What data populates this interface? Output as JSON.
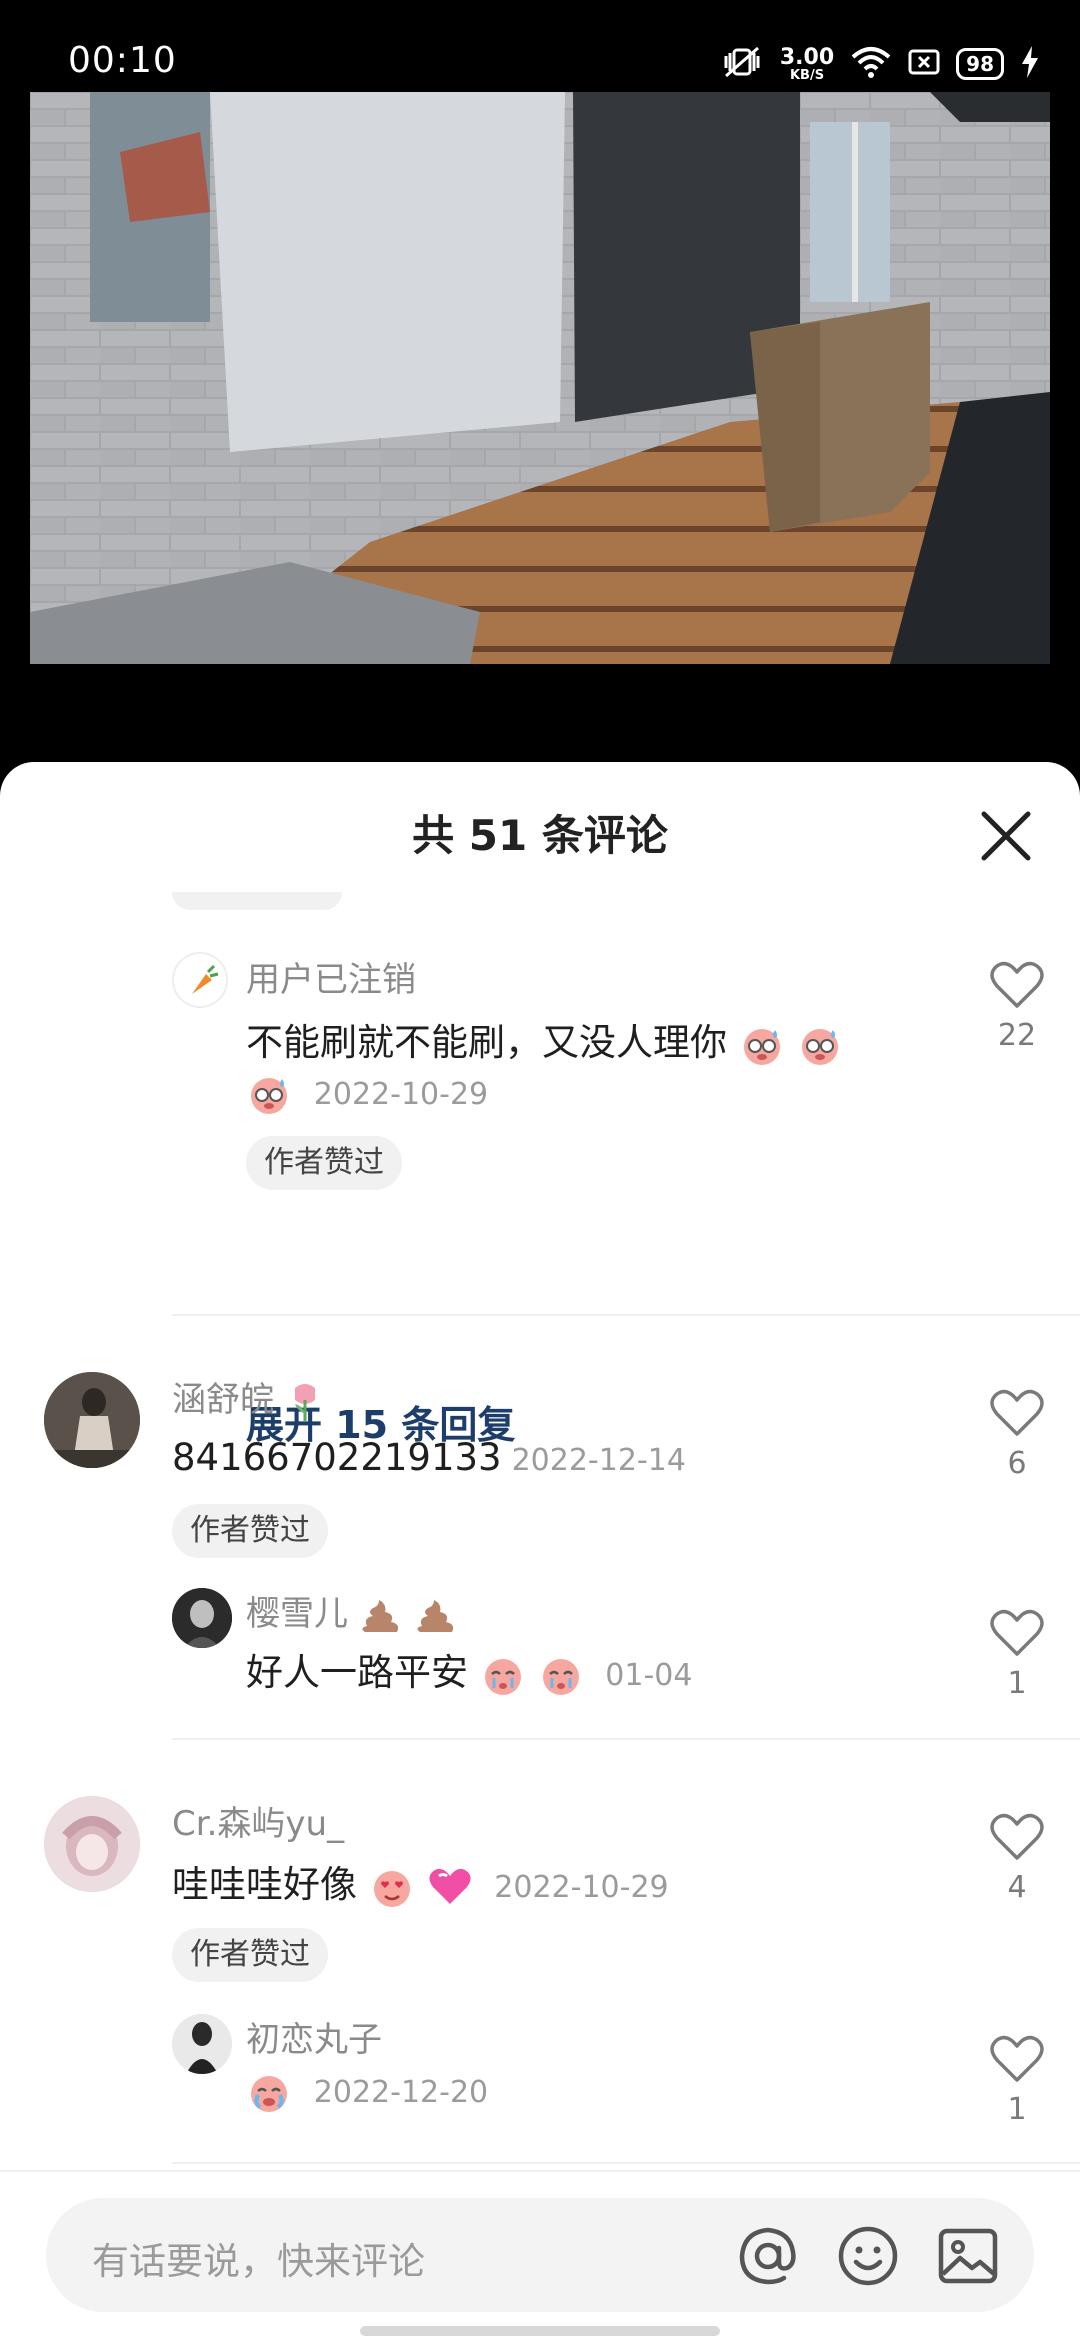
{
  "status_bar": {
    "time": "00:10",
    "net_speed": "3.00",
    "net_unit": "KB/S",
    "battery": "98",
    "icons": [
      "mute-vibrate-icon",
      "wifi-icon",
      "sim-icon",
      "battery-icon",
      "charging-icon"
    ]
  },
  "video": {
    "scene": "3d-room-scene"
  },
  "comments_sheet": {
    "title": "共 51 条评论",
    "comments": [
      {
        "user": "用户已注销",
        "text": "不能刷就不能刷，又没人理你",
        "date": "2022-10-29",
        "tag": "作者赞过",
        "likes": "22",
        "expand": "展开 15 条回复"
      },
      {
        "user": "涵舒皖",
        "text": "84166702219133",
        "date": "2022-12-14",
        "tag": "作者赞过",
        "likes": "6",
        "reply": {
          "user": "樱雪儿",
          "text": "好人一路平安",
          "date": "01-04",
          "likes": "1"
        }
      },
      {
        "user": "Cr.森屿yu_",
        "text": "哇哇哇好像",
        "date": "2022-10-29",
        "tag": "作者赞过",
        "likes": "4",
        "reply": {
          "user": "初恋丸子",
          "text": "",
          "date": "2022-12-20",
          "likes": "1"
        }
      }
    ]
  },
  "input_bar": {
    "placeholder": "有话要说，快来评论",
    "icons": [
      "at-icon",
      "emoji-icon",
      "image-icon"
    ]
  },
  "colors": {
    "accent_link": "#1d3e6a",
    "sheet_bg": "#ffffff",
    "tag_bg": "#f1f1f1"
  }
}
